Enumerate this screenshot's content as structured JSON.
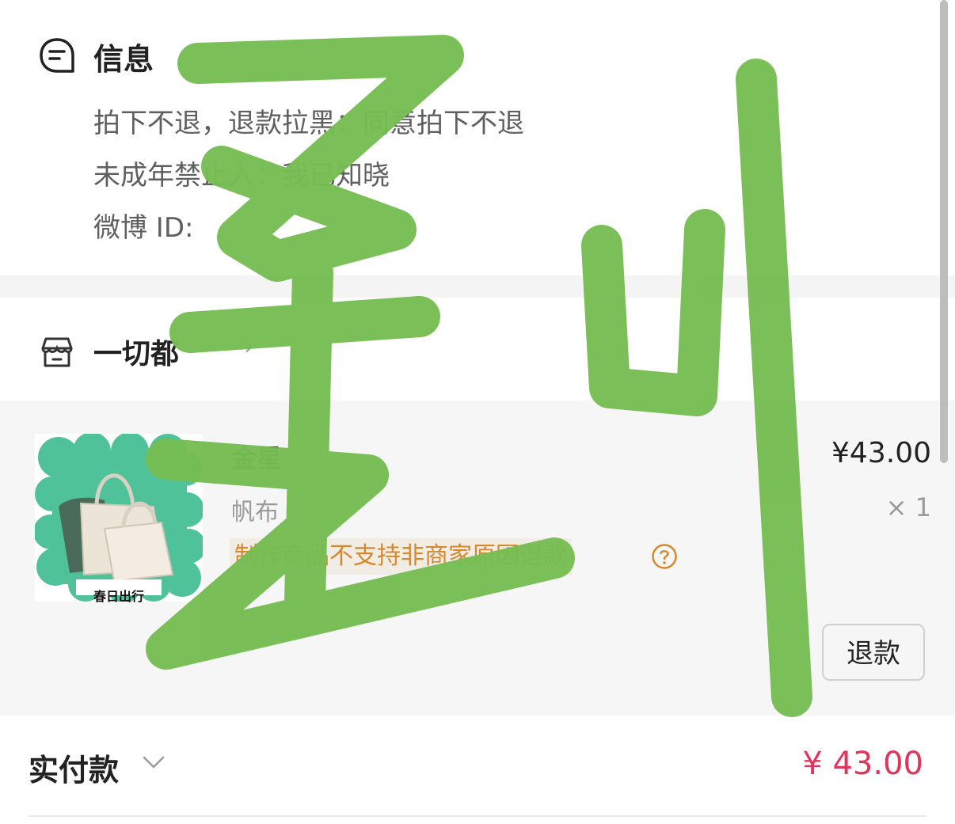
{
  "info": {
    "title": "信息",
    "lines": [
      "拍下不退，退款拉黑：同意拍下不退",
      "未成年禁止入：我已知晓",
      "微博 ID:"
    ]
  },
  "store": {
    "name": "一切都",
    "chevron": "›"
  },
  "item": {
    "thumb_caption": "春日出行",
    "title": "金星",
    "spec": "帆布",
    "notice": "制作商品不支持非商家原因退款",
    "help_icon": "question-circle-icon",
    "price": "¥43.00",
    "qty": "× 1",
    "refund_label": "退款"
  },
  "payment": {
    "label": "实付款",
    "amount": "¥ 43.00"
  },
  "overlay": {
    "text": "星川"
  },
  "colors": {
    "accent_red": "#e0345a",
    "notice_orange": "#d6892c",
    "overlay_green": "#76bd52",
    "thumb_teal": "#4fc29a"
  }
}
